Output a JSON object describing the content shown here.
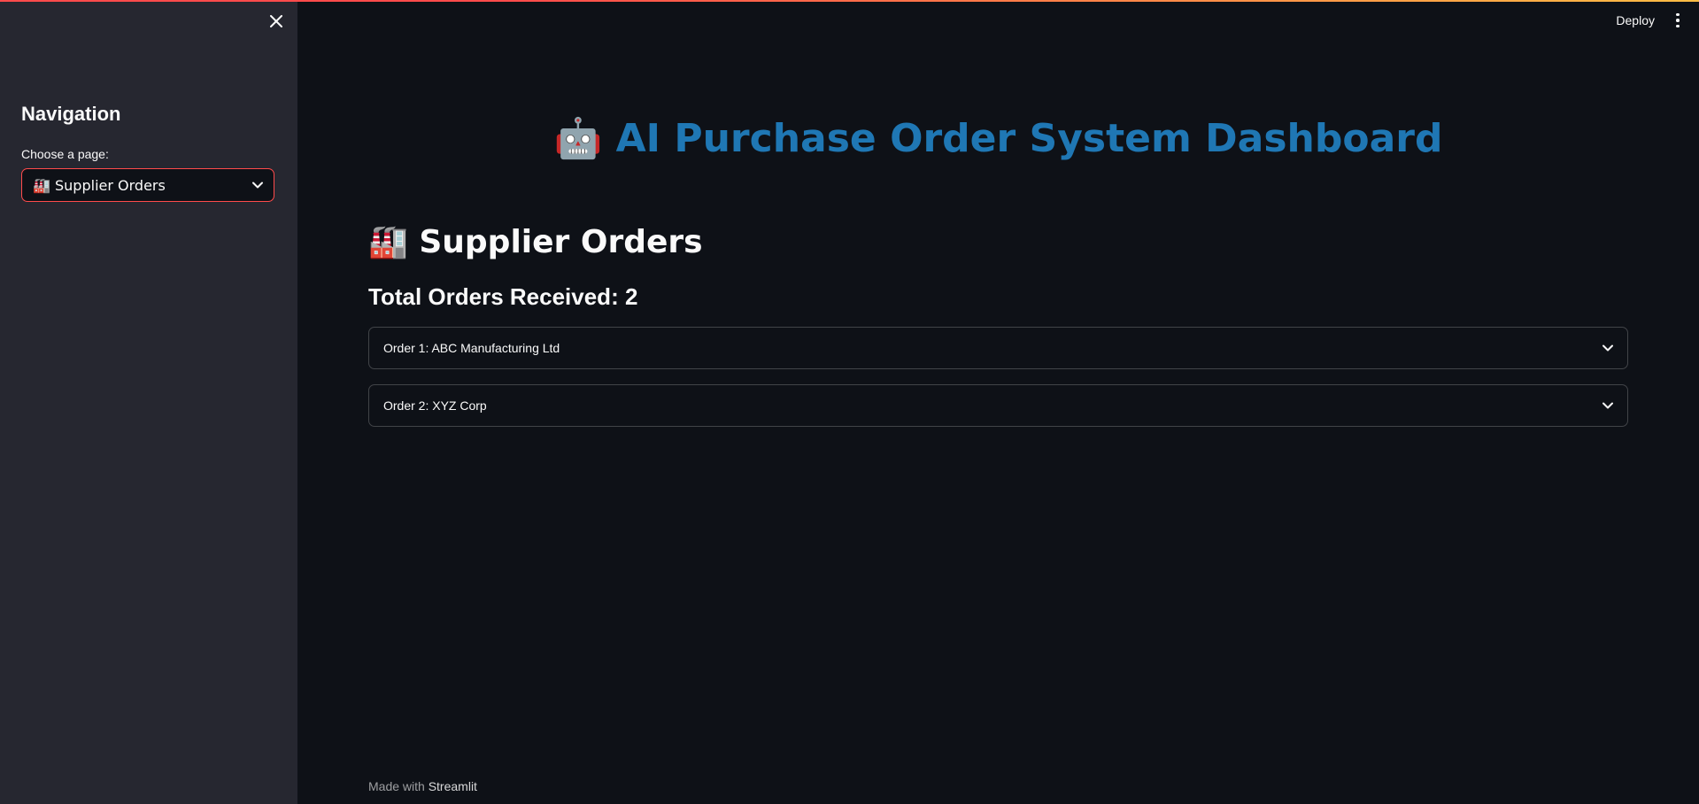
{
  "sidebar": {
    "close_icon": "close-icon",
    "heading": "Navigation",
    "select_label": "Choose a page:",
    "select_value": "🏭 Supplier Orders",
    "accent_color": "#ff4b4b",
    "background": "#262730"
  },
  "header": {
    "deploy_label": "Deploy",
    "menu_icon": "kebab-menu-icon"
  },
  "main": {
    "dashboard_title": "🤖 AI Purchase Order System Dashboard",
    "title_color": "#1f77b4",
    "section_title": "🏭 Supplier Orders",
    "total_orders": "Total Orders Received: 2",
    "orders": [
      {
        "label": "Order 1: ABC Manufacturing Ltd"
      },
      {
        "label": "Order 2: XYZ Corp"
      }
    ],
    "background": "#0e1117"
  },
  "footer": {
    "prefix": "Made with",
    "link": "Streamlit"
  }
}
